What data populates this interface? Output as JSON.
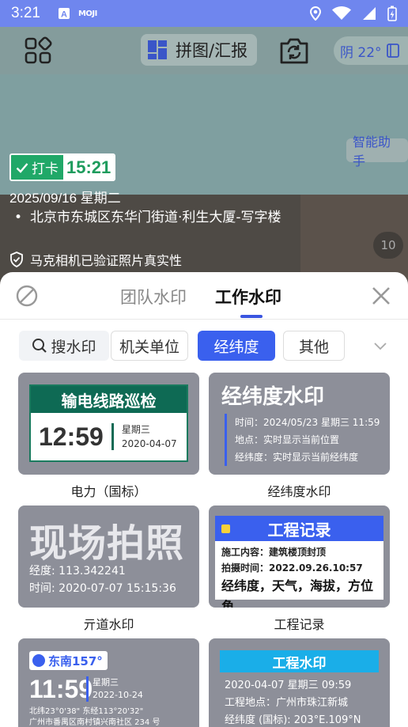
{
  "status_bar": {
    "time": "3:21",
    "moji": "MOJI"
  },
  "camera": {
    "collage_label": "拼图/汇报",
    "weather": "阴 22°",
    "assistant": "智能助手",
    "stamp_tag": "打卡",
    "stamp_time": "15:21",
    "date": "2025/09/16  星期二",
    "address": "北京市东城区东华门街道·利生大厦-写字楼",
    "verify": "马克相机已验证照片真实性",
    "photo_count": "10"
  },
  "sheet": {
    "tabs": [
      "团队水印",
      "工作水印"
    ],
    "search_label": "搜水印",
    "categories": [
      "机关单位",
      "经纬度",
      "其他"
    ],
    "templates": [
      {
        "caption": "电力（国标）",
        "header": "输电线路巡检",
        "time": "12:59",
        "weekday": "星期三",
        "date": "2020-04-07"
      },
      {
        "caption": "经纬度水印",
        "title": "经纬度水印",
        "lines": [
          "时间：2024/05/23 星期三 11:59",
          "地点：实时显示当前位置",
          "经纬度：实时显示当前经纬度"
        ]
      },
      {
        "caption": "亓道水印",
        "title": "现场拍照",
        "lines": [
          "经度: 113.342241",
          "时间: 2020-07-07 15:15:36"
        ]
      },
      {
        "caption": "工程记录",
        "header": "工程记录",
        "lines": [
          "施工内容：建筑楼顶封顶",
          "拍摄时间：2022.09.26.10:57"
        ],
        "footer": "经纬度，天气，海拔，方位角"
      },
      {
        "tag": "东南157°",
        "time": "11:59",
        "weekday": "星期三",
        "date": "2022-10-24",
        "lines": [
          "北纬23°0'38\" 东经113°20'32\"",
          "广州市番禺区南村镇兴南社区 234 号"
        ]
      },
      {
        "header": "工程水印",
        "lines": [
          "2020-04-07 星期三 09:59",
          "工程地点：广州市珠江新城",
          "经纬度 (国标): 203°E.109°N"
        ]
      }
    ]
  }
}
